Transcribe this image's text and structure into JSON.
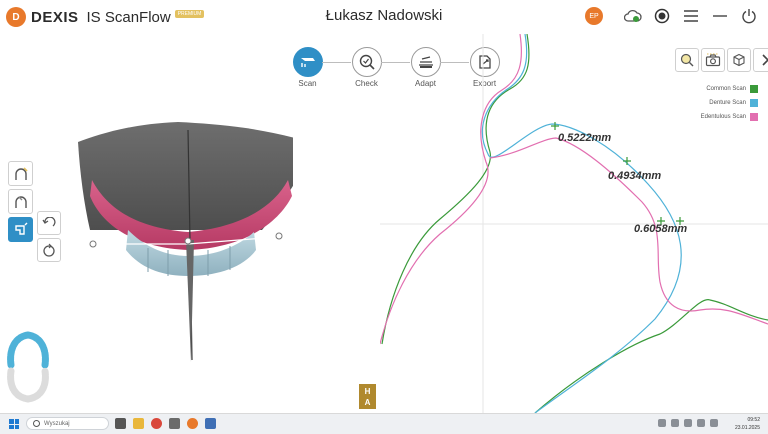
{
  "app": {
    "logo_mark": "D",
    "brand": "DEXIS",
    "product": "IS ScanFlow",
    "badge": "PREMIUM"
  },
  "patient_name": "Łukasz Nadowski",
  "header": {
    "avatar_initials": "EP",
    "icons": [
      "cloud-sync-icon",
      "record-icon",
      "menu-icon",
      "minimize-icon",
      "power-icon"
    ]
  },
  "workflow": {
    "steps": [
      {
        "label": "Scan",
        "active": true,
        "icon": "scan-icon"
      },
      {
        "label": "Check",
        "active": false,
        "icon": "check-icon"
      },
      {
        "label": "Adapt",
        "active": false,
        "icon": "adapt-icon"
      },
      {
        "label": "Export",
        "active": false,
        "icon": "export-icon"
      }
    ]
  },
  "view_tools": [
    "magnifier-icon",
    "camera-icon",
    "cube-view-icon",
    "chevron-right-icon"
  ],
  "legend": [
    {
      "label": "Common Scan",
      "color": "#3a9a3a"
    },
    {
      "label": "Denture Scan",
      "color": "#4fb2d8"
    },
    {
      "label": "Edentulous Scan",
      "color": "#e26fb0"
    }
  ],
  "measurements": [
    "0.5222mm",
    "0.4934mm",
    "0.6058mm"
  ],
  "ha_marker": {
    "top": "H",
    "bottom": "A"
  },
  "taskbar": {
    "search_placeholder": "Wyszukaj",
    "time": "09:52",
    "date": "23.01.2025"
  },
  "colors": {
    "accent": "#2f8fc6",
    "brand": "#e8792b",
    "teeth": "#a7c4cf",
    "gums": "#c2476f"
  }
}
